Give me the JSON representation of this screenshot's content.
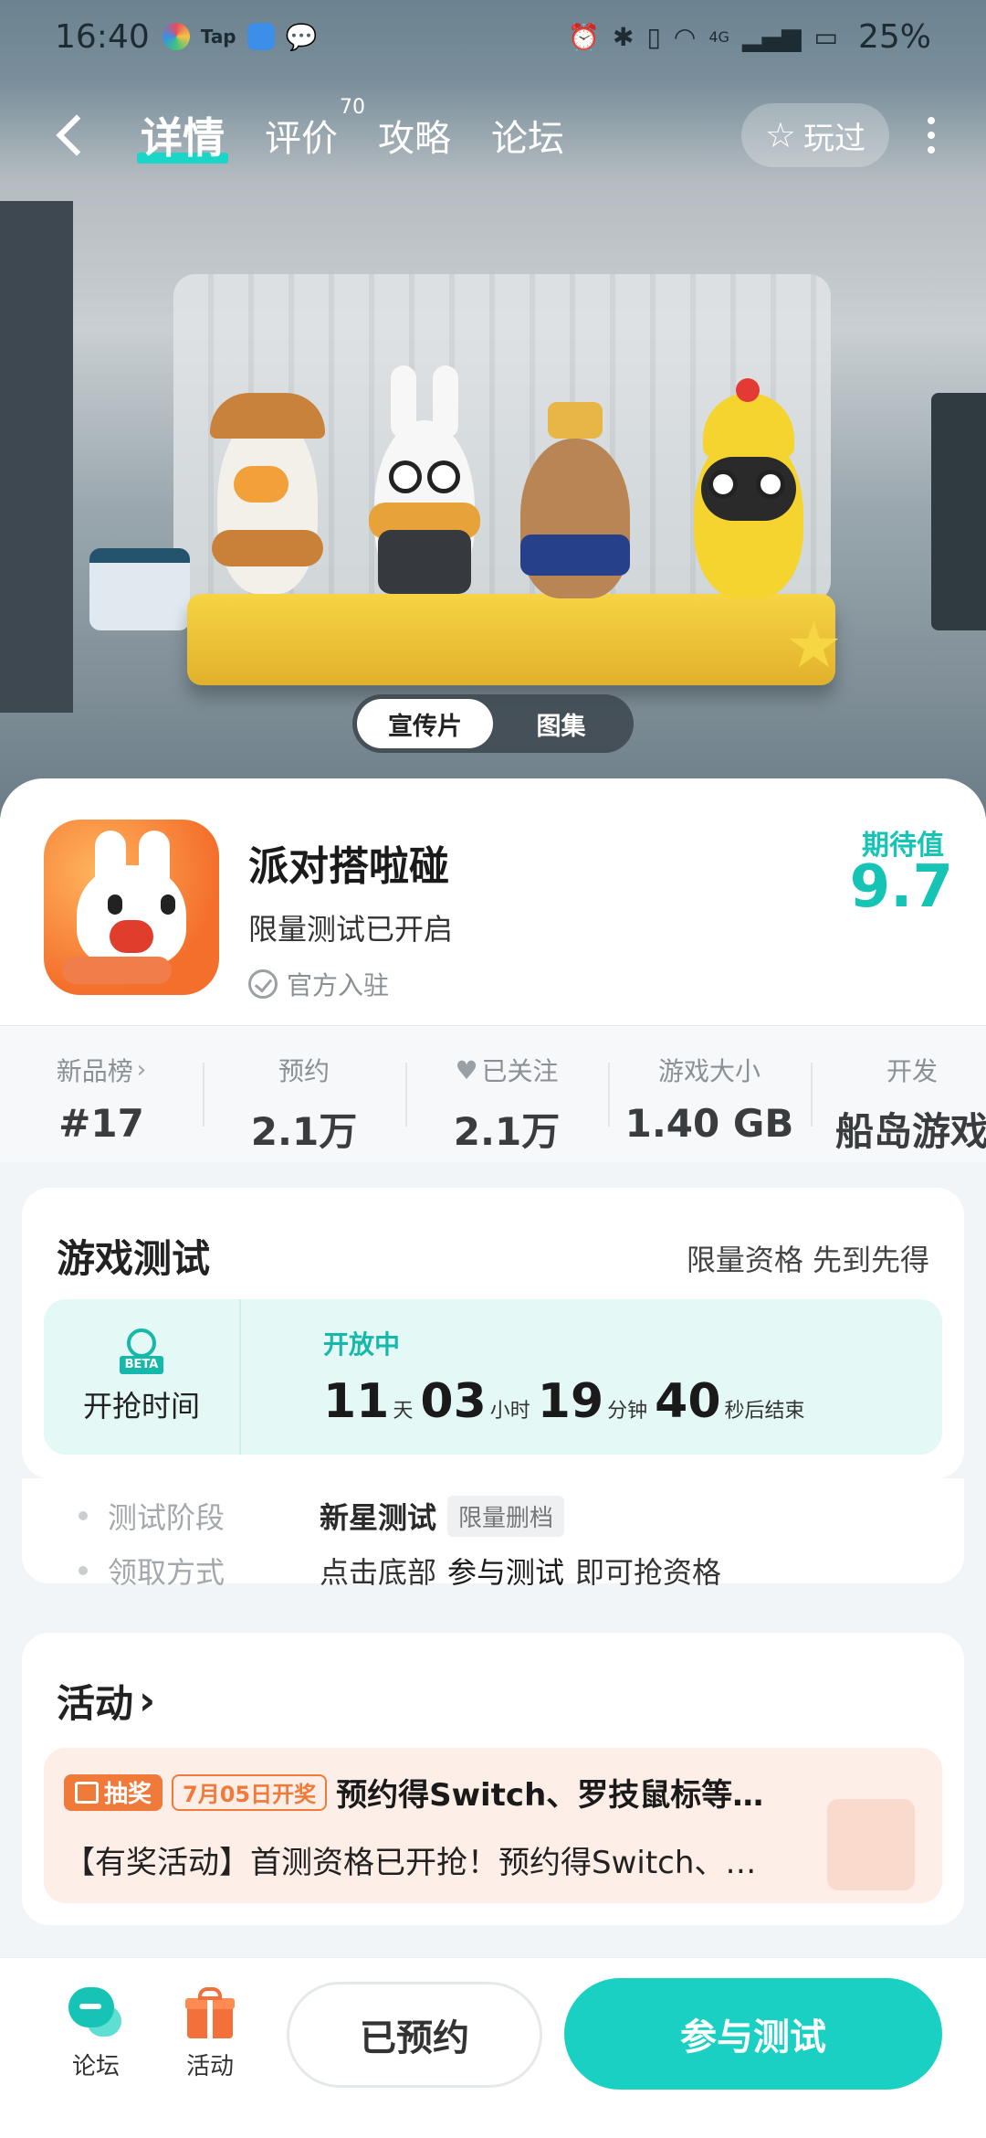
{
  "status_bar": {
    "time": "16:40",
    "tap_label": "Tap",
    "battery": "25%",
    "network": "4G"
  },
  "nav": {
    "tabs": [
      {
        "label": "详情",
        "active": true
      },
      {
        "label": "评价",
        "badge": "70"
      },
      {
        "label": "攻略"
      },
      {
        "label": "论坛"
      }
    ],
    "played_label": "玩过"
  },
  "media_toggle": {
    "options": [
      "宣传片",
      "图集"
    ],
    "active": "宣传片"
  },
  "game": {
    "name": "派对搭啦碰",
    "subtitle": "限量测试已开启",
    "official": "官方入驻",
    "expect_label": "期待值",
    "expect_value": "9.7"
  },
  "stats": [
    {
      "label": "新品榜",
      "value": "#17"
    },
    {
      "label": "预约",
      "value": "2.1万"
    },
    {
      "label": "已关注",
      "value": "2.1万"
    },
    {
      "label": "游戏大小",
      "value": "1.40 GB"
    },
    {
      "label": "开发",
      "value": "船岛游戏"
    }
  ],
  "game_test": {
    "title": "游戏测试",
    "note": "限量资格 先到先得",
    "icon_tag": "BETA",
    "countdown_label": "开抢时间",
    "status": "开放中",
    "days": "11",
    "days_unit": "天",
    "hours": "03",
    "hours_unit": "小时",
    "minutes": "19",
    "minutes_unit": "分钟",
    "seconds": "40",
    "seconds_unit": "秒后结束",
    "stage_label": "测试阶段",
    "stage_value": "新星测试",
    "stage_tag": "限量删档",
    "method_label": "领取方式",
    "method_pre": "点击底部",
    "method_bold": "参与测试",
    "method_post": "即可抢资格"
  },
  "activity": {
    "title": "活动",
    "badge": "抽奖",
    "date": "7月05日开奖",
    "item_title": "预约得Switch、罗技鼠标等…",
    "item_desc": "【有奖活动】首测资格已开抢！预约得Switch、…"
  },
  "bottom_bar": {
    "forum_label": "论坛",
    "activity_label": "活动",
    "reserved_label": "已预约",
    "join_label": "参与测试"
  },
  "colors": {
    "accent": "#16c4b6",
    "join_button": "#1ad0c2",
    "activity_orange": "#f07a3a"
  }
}
